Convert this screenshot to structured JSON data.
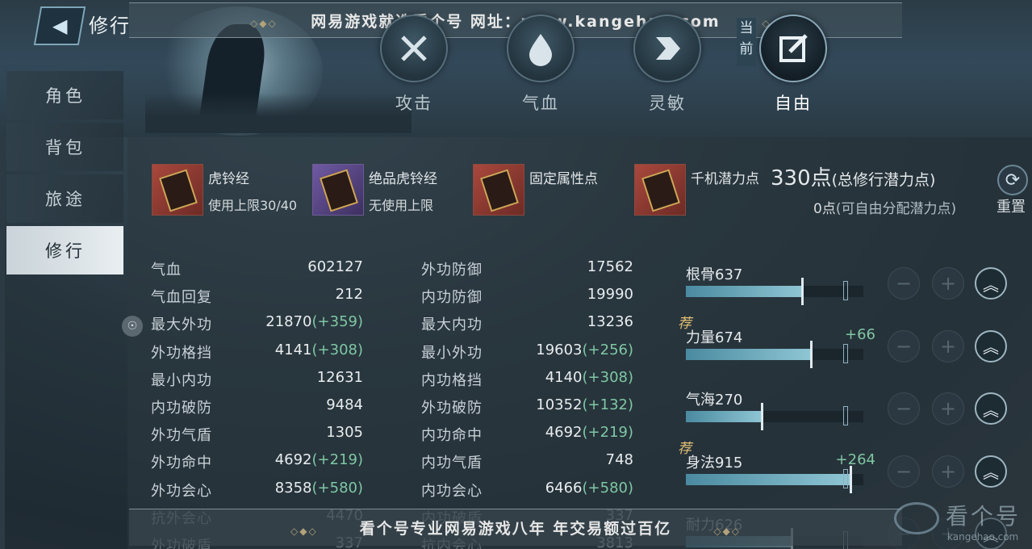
{
  "header": {
    "title": "修行",
    "watermark_top": "网易游戏就选看个号  网址：www.kangehao.com",
    "current_tag": "当前"
  },
  "top_tabs": [
    {
      "label": "攻击",
      "icon": "crossed-swords-icon"
    },
    {
      "label": "气血",
      "icon": "blood-drop-icon"
    },
    {
      "label": "灵敏",
      "icon": "agility-arrow-icon"
    },
    {
      "label": "自由",
      "icon": "edit-icon",
      "active": true
    }
  ],
  "sidebar": {
    "items": [
      {
        "label": "角色"
      },
      {
        "label": "背包"
      },
      {
        "label": "旅途"
      },
      {
        "label": "修行",
        "active": true
      }
    ]
  },
  "books": [
    {
      "title": "虎铃经",
      "sub": "使用上限30/40",
      "color": "red"
    },
    {
      "title": "绝品虎铃经",
      "sub": "无使用上限",
      "color": "purple"
    },
    {
      "title": "固定属性点",
      "sub": "",
      "color": "red"
    },
    {
      "title": "千机潜力点",
      "sub": "",
      "color": "red"
    }
  ],
  "potential": {
    "total_value": "330点",
    "total_label": "(总修行潜力点)",
    "free_value": "0点",
    "free_label": "(可自由分配潜力点)",
    "reset_label": "重置"
  },
  "stats_left": [
    {
      "name": "气血",
      "value": "602127",
      "bonus": ""
    },
    {
      "name": "气血回复",
      "value": "212",
      "bonus": ""
    },
    {
      "name": "最大外功",
      "value": "21870",
      "bonus": "(+359)"
    },
    {
      "name": "外功格挡",
      "value": "4141",
      "bonus": "(+308)"
    },
    {
      "name": "最小内功",
      "value": "12631",
      "bonus": ""
    },
    {
      "name": "内功破防",
      "value": "9484",
      "bonus": ""
    },
    {
      "name": "外功气盾",
      "value": "1305",
      "bonus": ""
    },
    {
      "name": "外功命中",
      "value": "4692",
      "bonus": "(+219)"
    },
    {
      "name": "外功会心",
      "value": "8358",
      "bonus": "(+580)"
    },
    {
      "name": "抗外会心",
      "value": "4470",
      "bonus": ""
    },
    {
      "name": "外功破盾",
      "value": "337",
      "bonus": ""
    }
  ],
  "stats_right": [
    {
      "name": "外功防御",
      "value": "17562",
      "bonus": ""
    },
    {
      "name": "内功防御",
      "value": "19990",
      "bonus": ""
    },
    {
      "name": "最大内功",
      "value": "13236",
      "bonus": ""
    },
    {
      "name": "最小外功",
      "value": "19603",
      "bonus": "(+256)"
    },
    {
      "name": "内功格挡",
      "value": "4140",
      "bonus": "(+308)"
    },
    {
      "name": "外功破防",
      "value": "10352",
      "bonus": "(+132)"
    },
    {
      "name": "内功命中",
      "value": "4692",
      "bonus": "(+219)"
    },
    {
      "name": "内功气盾",
      "value": "748",
      "bonus": ""
    },
    {
      "name": "内功会心",
      "value": "6466",
      "bonus": "(+580)"
    },
    {
      "name": "内功破盾",
      "value": "337",
      "bonus": ""
    },
    {
      "name": "抗内会心",
      "value": "3813",
      "bonus": ""
    }
  ],
  "attributes": [
    {
      "name": "根骨637",
      "bonus": "",
      "recommended": false,
      "fill": 0.66
    },
    {
      "name": "力量674",
      "bonus": "+66",
      "recommended": true,
      "fill": 0.71
    },
    {
      "name": "气海270",
      "bonus": "",
      "recommended": false,
      "fill": 0.43
    },
    {
      "name": "身法915",
      "bonus": "+264",
      "recommended": true,
      "fill": 0.93
    },
    {
      "name": "耐力626",
      "bonus": "",
      "recommended": false,
      "fill": 0.6
    }
  ],
  "recommend_tag": "荐",
  "watermark_bottom": "看个号专业网易游戏八年  年交易额过百亿",
  "brand": {
    "name": "看个号",
    "url": "kangehao.com"
  }
}
